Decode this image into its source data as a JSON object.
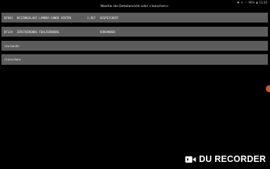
{
  "status_bar": {
    "battery": "96%",
    "time": "13:30"
  },
  "header": {
    "title": "Waehle die Detailansicht oder <loeschen>:"
  },
  "list": {
    "rows": [
      {
        "code": "DF003",
        "desc": "HEIZUNGSLAUF LAMBDA-SONDE HINTEN",
        "value": "2.DEF",
        "status": "GESPEICHERT"
      },
      {
        "code": "DF124",
        "desc": "ZERSTOERENDE FEHLZUENDUNG",
        "value": "",
        "status": "VORHANDEN"
      }
    ],
    "back_label": "<zurueck>",
    "delete_label": "<loeschen>"
  },
  "watermark": {
    "text": "DU RECORDER"
  },
  "colors": {
    "row_bg": "#5c5c5c",
    "page_bg": "#000000",
    "edge_handle": "#c25a2a"
  }
}
